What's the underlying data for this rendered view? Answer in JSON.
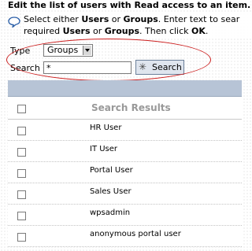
{
  "page": {
    "heading": "Edit the list of users with Read access to an item."
  },
  "help": {
    "icon": "speech-bubble-icon",
    "line1_prefix": "Select either ",
    "line1_users": "Users",
    "line1_or": " or ",
    "line1_groups": "Groups",
    "line1_suffix": ". Enter text to sear",
    "line2_prefix": "required ",
    "line2_users": "Users",
    "line2_or": " or ",
    "line2_groups": "Groups",
    "line2_mid": ". Then click ",
    "line2_ok": "OK",
    "line2_end": "."
  },
  "form": {
    "type_label": "Type",
    "type_selected": "Groups",
    "search_label": "Search",
    "search_value": "*",
    "search_button_label": "Search",
    "highlight_color": "#cc1f1f"
  },
  "results": {
    "header": "Search Results",
    "rows": [
      "HR User",
      "IT User",
      "Portal User",
      "Sales User",
      "wpsadmin",
      "anonymous portal user"
    ]
  }
}
